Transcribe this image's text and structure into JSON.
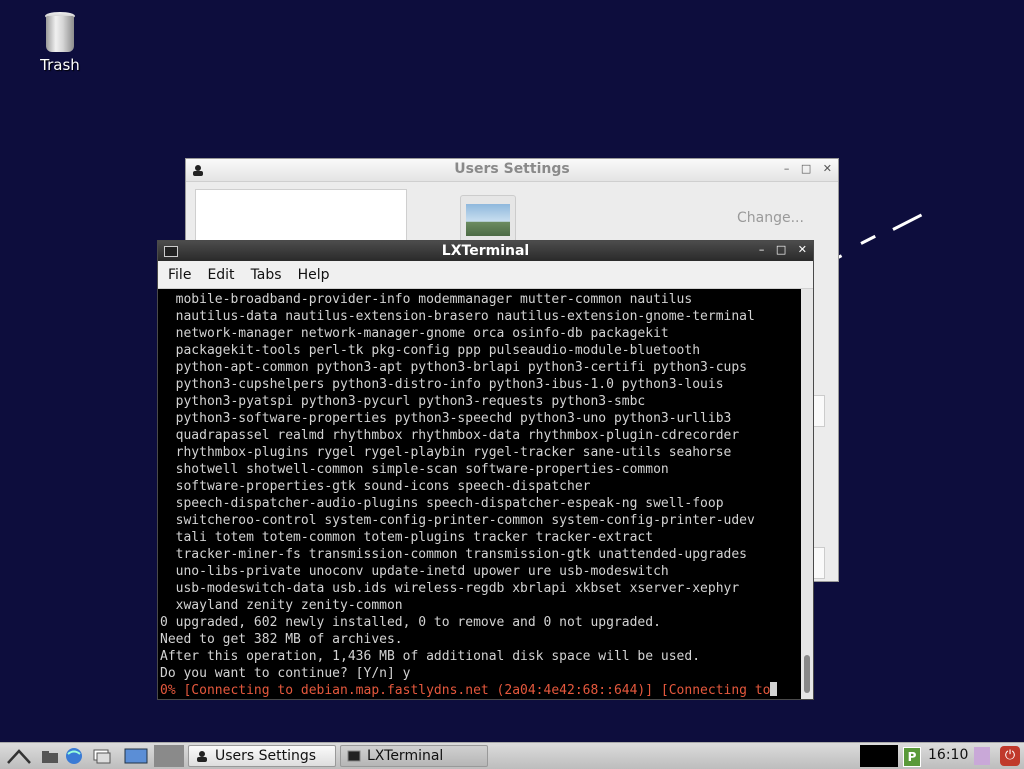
{
  "desktop": {
    "trash_label": "Trash"
  },
  "users_window": {
    "title": "Users Settings",
    "change_label": "Change..."
  },
  "terminal": {
    "title": "LXTerminal",
    "menu": [
      "File",
      "Edit",
      "Tabs",
      "Help"
    ],
    "lines": [
      "  mobile-broadband-provider-info modemmanager mutter-common nautilus",
      "  nautilus-data nautilus-extension-brasero nautilus-extension-gnome-terminal",
      "  network-manager network-manager-gnome orca osinfo-db packagekit",
      "  packagekit-tools perl-tk pkg-config ppp pulseaudio-module-bluetooth",
      "  python-apt-common python3-apt python3-brlapi python3-certifi python3-cups",
      "  python3-cupshelpers python3-distro-info python3-ibus-1.0 python3-louis",
      "  python3-pyatspi python3-pycurl python3-requests python3-smbc",
      "  python3-software-properties python3-speechd python3-uno python3-urllib3",
      "  quadrapassel realmd rhythmbox rhythmbox-data rhythmbox-plugin-cdrecorder",
      "  rhythmbox-plugins rygel rygel-playbin rygel-tracker sane-utils seahorse",
      "  shotwell shotwell-common simple-scan software-properties-common",
      "  software-properties-gtk sound-icons speech-dispatcher",
      "  speech-dispatcher-audio-plugins speech-dispatcher-espeak-ng swell-foop",
      "  switcheroo-control system-config-printer-common system-config-printer-udev",
      "  tali totem totem-common totem-plugins tracker tracker-extract",
      "  tracker-miner-fs transmission-common transmission-gtk unattended-upgrades",
      "  uno-libs-private unoconv update-inetd upower ure usb-modeswitch",
      "  usb-modeswitch-data usb.ids wireless-regdb xbrlapi xkbset xserver-xephyr",
      "  xwayland zenity zenity-common",
      "0 upgraded, 602 newly installed, 0 to remove and 0 not upgraded.",
      "Need to get 382 MB of archives.",
      "After this operation, 1,436 MB of additional disk space will be used.",
      "Do you want to continue? [Y/n] y"
    ],
    "progress_line": "0% [Connecting to debian.map.fastlydns.net (2a04:4e42:68::644)] [Connecting to"
  },
  "taskbar": {
    "tasks": [
      "Users Settings",
      "LXTerminal"
    ],
    "tray_p": "P",
    "clock": "16:10"
  }
}
